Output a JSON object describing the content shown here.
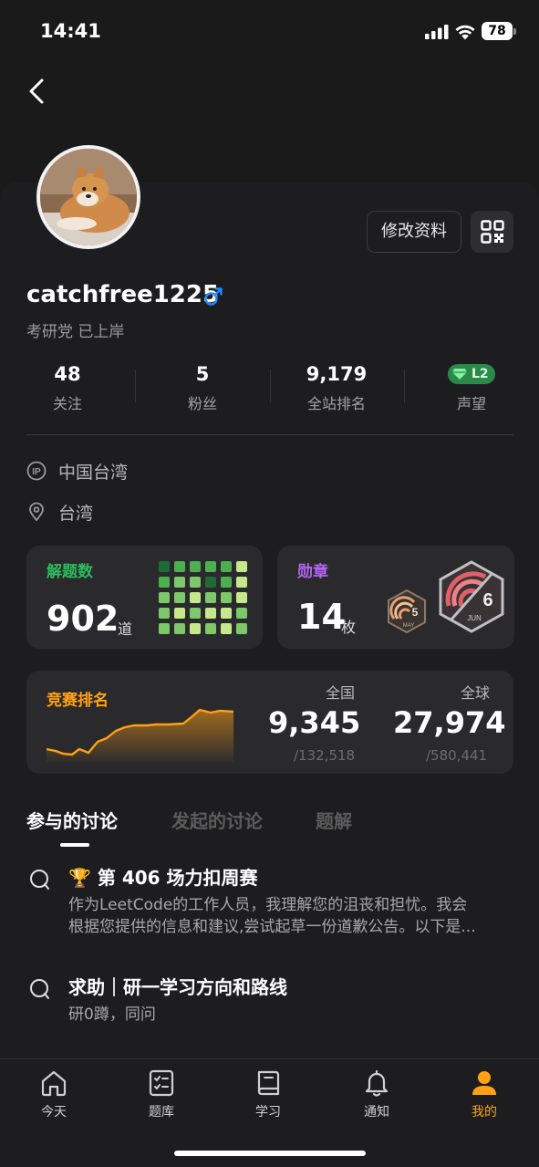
{
  "status_bar": {
    "time": "14:41",
    "battery": "78"
  },
  "profile": {
    "username": "catchfree1225",
    "bio": "考研党 已上岸",
    "edit_label": "修改资料",
    "avatar_icon": "avatar-shiba-dog-photo",
    "gender_icon": "male-icon"
  },
  "stats": [
    {
      "value": "48",
      "label": "关注"
    },
    {
      "value": "5",
      "label": "粉丝"
    },
    {
      "value": "9,179",
      "label": "全站排名"
    },
    {
      "badge": "L2",
      "label": "声望"
    }
  ],
  "info": {
    "ip_location": "中国台湾",
    "location": "台湾"
  },
  "solved": {
    "title": "解题数",
    "count": "902",
    "unit": "道"
  },
  "badges": {
    "title": "勋章",
    "count": "14",
    "unit": "枚",
    "small_badge": {
      "day": "5",
      "month": "MAY"
    },
    "large_badge": {
      "day": "6",
      "month": "JUN"
    }
  },
  "contest": {
    "title": "竞赛排名",
    "national_label": "全国",
    "national_rank": "9,345",
    "national_total": "/132,518",
    "global_label": "全球",
    "global_rank": "27,974",
    "global_total": "/580,441"
  },
  "tabs": [
    {
      "label": "参与的讨论",
      "active": true
    },
    {
      "label": "发起的讨论",
      "active": false
    },
    {
      "label": "题解",
      "active": false
    }
  ],
  "discussions": [
    {
      "emoji": "🏆",
      "title": "第 406 场力扣周赛",
      "line1": "作为LeetCode的工作人员，我理解您的沮丧和担忧。我会",
      "line2": "根据您提供的信息和建议,尝试起草一份道歉公告。以下是..."
    },
    {
      "title": "求助｜研一学习方向和路线",
      "line1": "研0蹲，同问"
    }
  ],
  "nav": [
    {
      "label": "今天",
      "icon": "home-icon"
    },
    {
      "label": "题库",
      "icon": "problem-list-icon"
    },
    {
      "label": "学习",
      "icon": "book-icon"
    },
    {
      "label": "通知",
      "icon": "bell-icon"
    },
    {
      "label": "我的",
      "icon": "user-icon",
      "active": true
    }
  ],
  "colors": {
    "accent": "#ffa116",
    "solved_title": "#2cbb5d",
    "badge_title": "#b563f5",
    "contest_title": "#ffa116",
    "male_blue": "#1f8bff"
  }
}
